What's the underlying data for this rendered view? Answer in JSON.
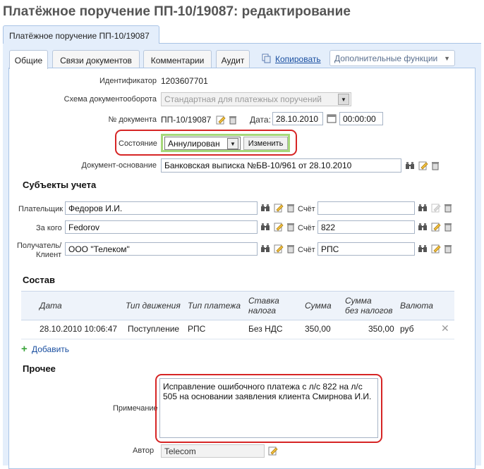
{
  "page": {
    "title": "Платёжное поручение ПП-10/19087: редактирование"
  },
  "outer_tab": {
    "label": "Платёжное поручение ПП-10/19087"
  },
  "tabs": [
    {
      "label": "Общие"
    },
    {
      "label": "Связи документов"
    },
    {
      "label": "Комментарии"
    },
    {
      "label": "Аудит"
    }
  ],
  "toolbar": {
    "copy_label": "Копировать",
    "extra_label": "Дополнительные функции"
  },
  "general": {
    "id_label": "Идентификатор",
    "id_value": "1203607701",
    "scheme_label": "Схема документооборота",
    "scheme_value": "Стандартная для платежных поручений",
    "docnum_label": "№ документа",
    "docnum_value": "ПП-10/19087",
    "date_label": "Дата:",
    "date_value": "28.10.2010",
    "time_value": "00:00:00",
    "state_label": "Состояние",
    "state_value": "Аннулирован",
    "change_label": "Изменить",
    "basis_label": "Документ-основание",
    "basis_value": "Банковская выписка №БВ-10/961 от 28.10.2010"
  },
  "subjects": {
    "title": "Субъекты учета",
    "rows": [
      {
        "label": "Плательщик",
        "value": "Федоров И.И.",
        "account_label": "Счёт",
        "account_value": ""
      },
      {
        "label": "За кого",
        "value": "Fedorov",
        "account_label": "Счёт",
        "account_value": "822"
      },
      {
        "label_line1": "Получатель/",
        "label_line2": "Клиент",
        "value": "ООО \"Телеком\"",
        "account_label": "Счёт",
        "account_value": "РПС"
      }
    ]
  },
  "composition": {
    "title": "Состав",
    "headers": {
      "date": "Дата",
      "move": "Тип движения",
      "pay": "Тип платежа",
      "tax_line1": "Ставка",
      "tax_line2": "налога",
      "sum": "Сумма",
      "net_line1": "Сумма",
      "net_line2": "без налогов",
      "cur": "Валюта"
    },
    "rows": [
      {
        "date": "28.10.2010 10:06:47",
        "move": "Поступление",
        "pay": "РПС",
        "tax": "Без НДС",
        "sum": "350,00",
        "net": "350,00",
        "cur": "руб"
      }
    ],
    "add_label": "Добавить"
  },
  "other": {
    "title": "Прочее",
    "note_label": "Примечание",
    "note_value": "Исправление ошибочного платежа с л/с 822 на л/с 505 на основании заявления клиента Смирнова И.И.",
    "author_label": "Автор",
    "author_value": "Telecom"
  },
  "colors": {
    "highlight": "#d62525",
    "panel": "#e4eefb",
    "link": "#1a4fa0",
    "state_frame": "#a6d87a"
  }
}
